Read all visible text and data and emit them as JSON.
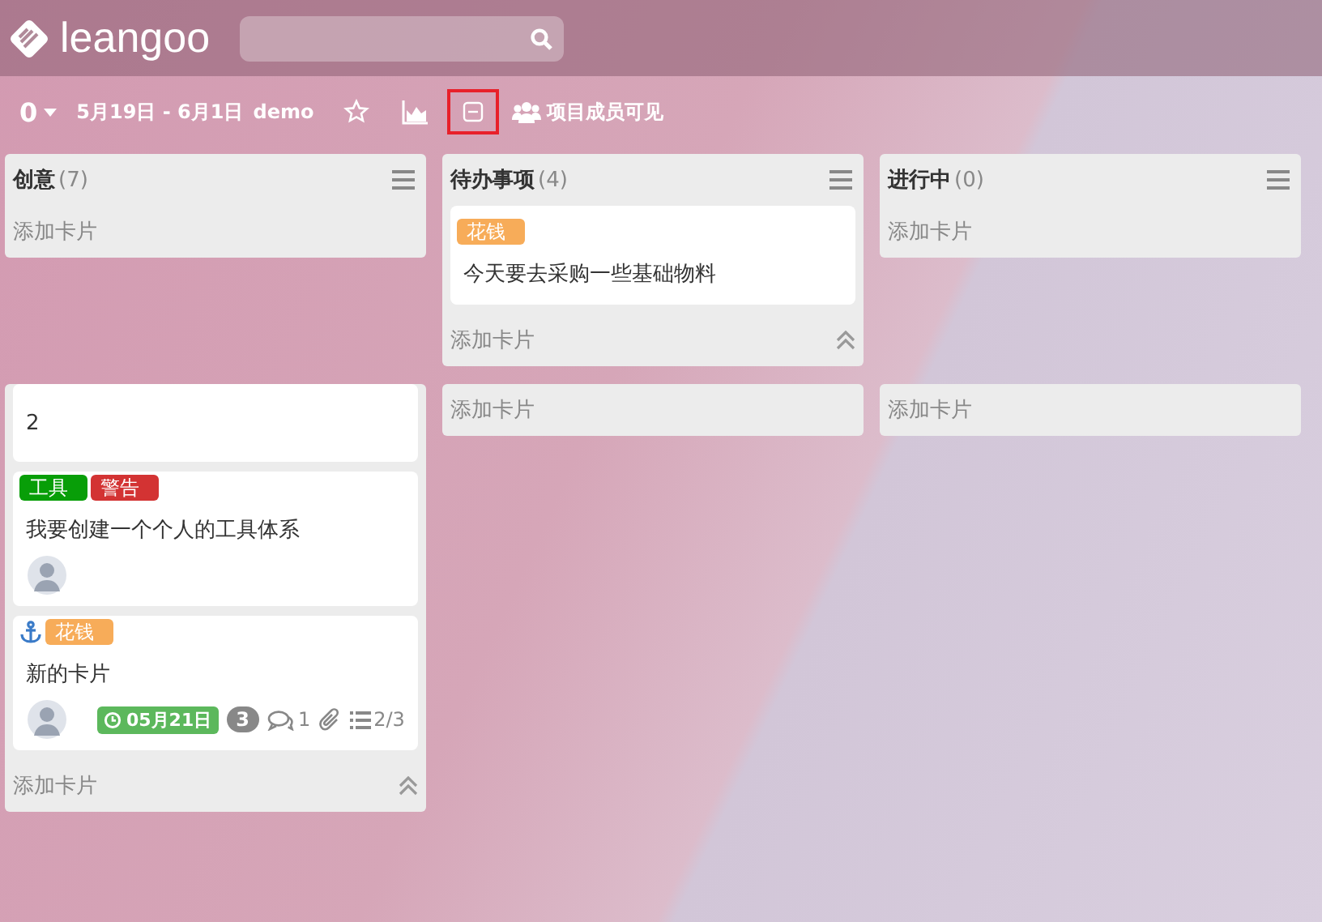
{
  "header": {
    "logo": "leangoo"
  },
  "toolbar": {
    "count": "0",
    "date_range": "5月19日 - 6月1日",
    "board": "demo",
    "tools": [
      {
        "kind": "star",
        "selected": false
      },
      {
        "kind": "chart",
        "selected": false
      },
      {
        "kind": "collapse",
        "selected": true
      }
    ],
    "visibility": "项目成员可见"
  },
  "columns": [
    {
      "title": "创意",
      "count": "(7)"
    },
    {
      "title": "待办事项",
      "count": "(4)"
    },
    {
      "title": "进行中",
      "count": "(0)"
    }
  ],
  "lanes": [
    {
      "cells": [
        {
          "add": "添加卡片"
        },
        {
          "cards": [
            {
              "labels": [
                {
                  "text": "花钱",
                  "color": "#f7ac59"
                }
              ],
              "title": "今天要去采购一些基础物料"
            }
          ],
          "add": "添加卡片",
          "collapse": true
        },
        {
          "add": "添加卡片"
        }
      ]
    },
    {
      "cells": [
        {
          "cards": [
            {
              "title": "2"
            },
            {
              "labels": [
                {
                  "text": "工具",
                  "color": "#089e08"
                },
                {
                  "text": "警告",
                  "color": "#d33333"
                }
              ],
              "title": "我要创建一个个人的工具体系",
              "avatar": true
            },
            {
              "labels": [
                {
                  "text": "花钱",
                  "color": "#f7ac59"
                }
              ],
              "title": "新的卡片",
              "anchor": true,
              "avatar": true,
              "badges": {
                "due": "05月21日",
                "count": "3",
                "comments": "1",
                "attachment": true,
                "checklist": "2/3"
              }
            }
          ],
          "add": "添加卡片",
          "collapse": true
        },
        {
          "add": "添加卡片"
        },
        {
          "add": "添加卡片"
        }
      ]
    }
  ]
}
